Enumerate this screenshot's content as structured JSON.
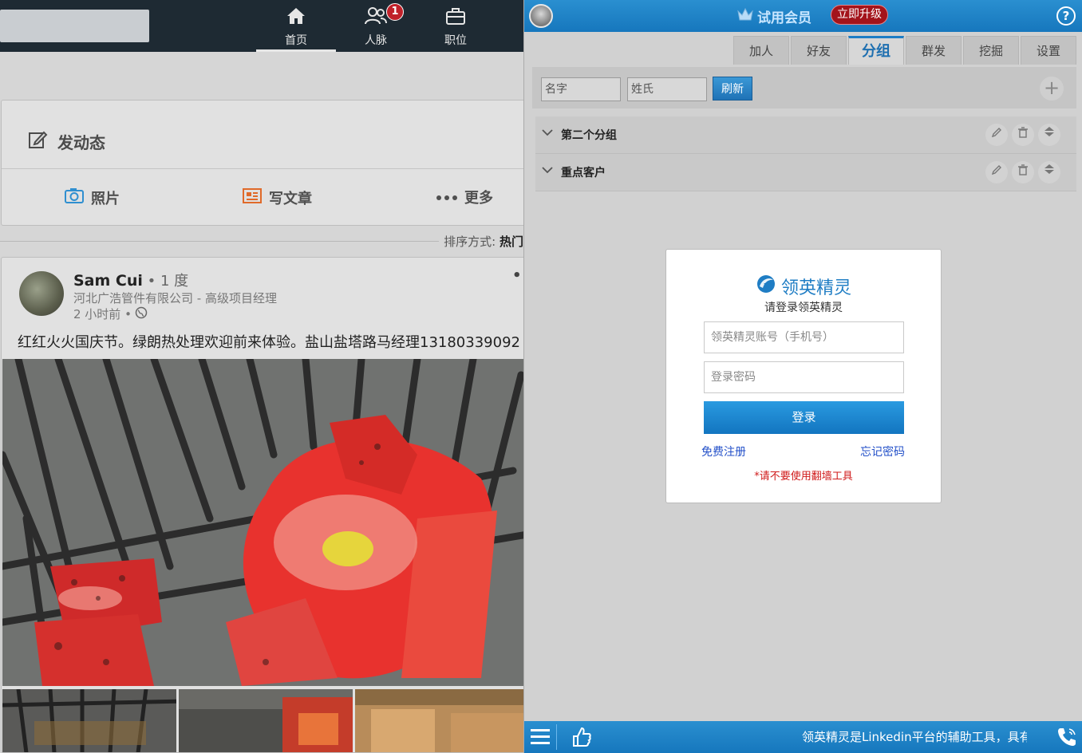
{
  "linkedin": {
    "nav": [
      {
        "label": "首页",
        "icon": "home-icon"
      },
      {
        "label": "人脉",
        "icon": "people-icon",
        "badge": "1"
      },
      {
        "label": "职位",
        "icon": "briefcase-icon"
      }
    ],
    "share": {
      "prompt": "发动态",
      "actions": [
        {
          "label": "照片",
          "icon": "camera-icon"
        },
        {
          "label": "写文章",
          "icon": "article-icon"
        },
        {
          "label": "更多",
          "icon": "more-dots-icon"
        }
      ]
    },
    "sort": {
      "label": "排序方式:",
      "value": "热门"
    },
    "post": {
      "author_name": "Sam Cui",
      "degree": " • 1 度",
      "title": "河北广浩管件有限公司 - 高级项目经理",
      "time": "2 小时前 •",
      "text": "红红火火国庆节。绿朗热处理欢迎前来体验。盐山盐塔路马经理13180339092",
      "more": "••"
    }
  },
  "plugin": {
    "member_label": "试用会员",
    "upgrade_label": "立即升级",
    "help_label": "?",
    "tabs": [
      "加人",
      "好友",
      "分组",
      "群发",
      "挖掘",
      "设置"
    ],
    "active_tab": "分组",
    "toolbar": {
      "first_name_placeholder": "名字",
      "last_name_placeholder": "姓氏",
      "refresh_label": "刷新",
      "add_label": "+"
    },
    "groups": [
      {
        "name": "第二个分组"
      },
      {
        "name": "重点客户"
      }
    ],
    "login": {
      "brand": "领英精灵",
      "subtitle": "请登录领英精灵",
      "account_placeholder": "领英精灵账号（手机号）",
      "password_placeholder": "登录密码",
      "login_label": "登录",
      "register_label": "免费注册",
      "forgot_label": "忘记密码",
      "warning": "*请不要使用翻墙工具"
    },
    "footer_text": "领英精灵是Linkedin平台的辅助工具，具有"
  },
  "colors": {
    "plugin_blue": "#1677bd",
    "upgrade_red": "#a3141b",
    "warning_red": "#d01a1a",
    "nav_dark": "#1e2a33"
  }
}
